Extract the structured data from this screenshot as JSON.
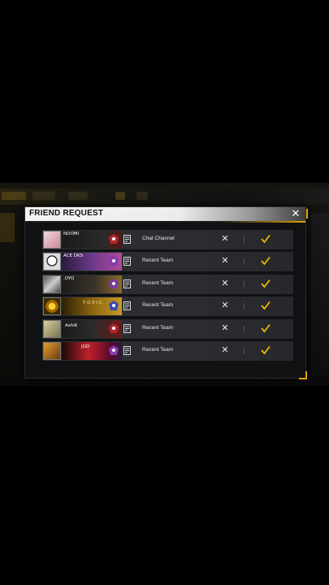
{
  "dialog": {
    "title": "FRIEND REQUEST",
    "close_icon": "close-icon"
  },
  "requests": [
    {
      "name": "NOOMI",
      "source": "Chat Channel"
    },
    {
      "name": "ACE DKS",
      "source": "Recent Team"
    },
    {
      "name": ".OYO",
      "source": "Recent Team"
    },
    {
      "name": "T O X I C",
      "source": "Recent Team"
    },
    {
      "name": "AshiK",
      "source": "Recent Team"
    },
    {
      "name": "JOD",
      "source": "Recent Team"
    }
  ],
  "actions": {
    "reject_icon": "close-icon",
    "accept_icon": "check-icon"
  },
  "colors": {
    "accent": "#e7a400",
    "row_bg": "#2d2f33",
    "check": "#f2b705"
  }
}
